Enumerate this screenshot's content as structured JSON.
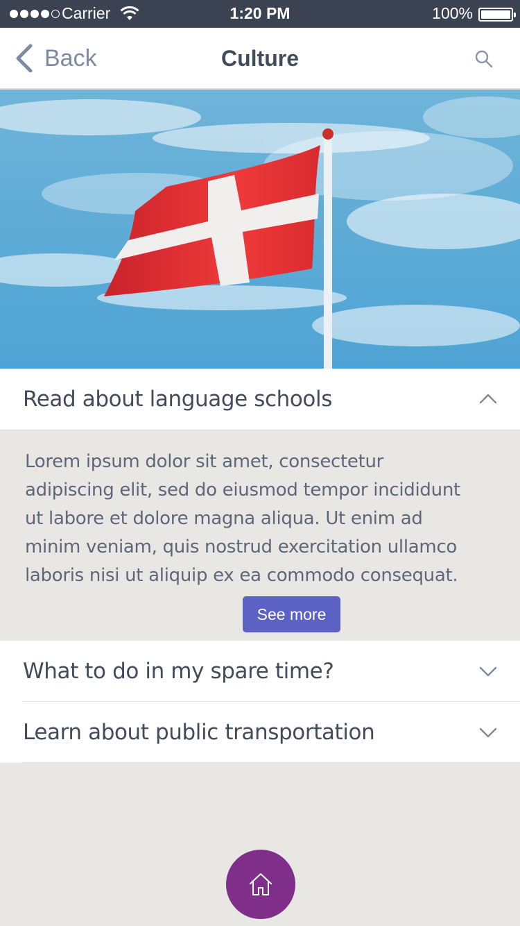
{
  "status_bar": {
    "carrier": "Carrier",
    "time": "1:20 PM",
    "battery": "100%"
  },
  "nav": {
    "back_label": "Back",
    "title": "Culture",
    "search_icon": "search-icon"
  },
  "colors": {
    "status_bar": "#3b4352",
    "accent_button": "#5b62c4",
    "home_button": "#7f2f8a",
    "text_dark": "#414b5a"
  },
  "accordion": {
    "items": [
      {
        "label": "Read about language schools",
        "expanded": true,
        "body": "Lorem ipsum dolor sit amet, consectetur adipiscing elit, sed do eiusmod tempor incididunt ut labore et dolore magna aliqua. Ut enim ad minim veniam, quis nostrud exercitation ullamco laboris nisi ut aliquip ex ea commodo consequat.",
        "button_label": "See more"
      },
      {
        "label": "What to do in my spare time?",
        "expanded": false
      },
      {
        "label": "Learn about public transportation",
        "expanded": false
      }
    ]
  },
  "footer": {
    "home_icon": "home-icon"
  }
}
